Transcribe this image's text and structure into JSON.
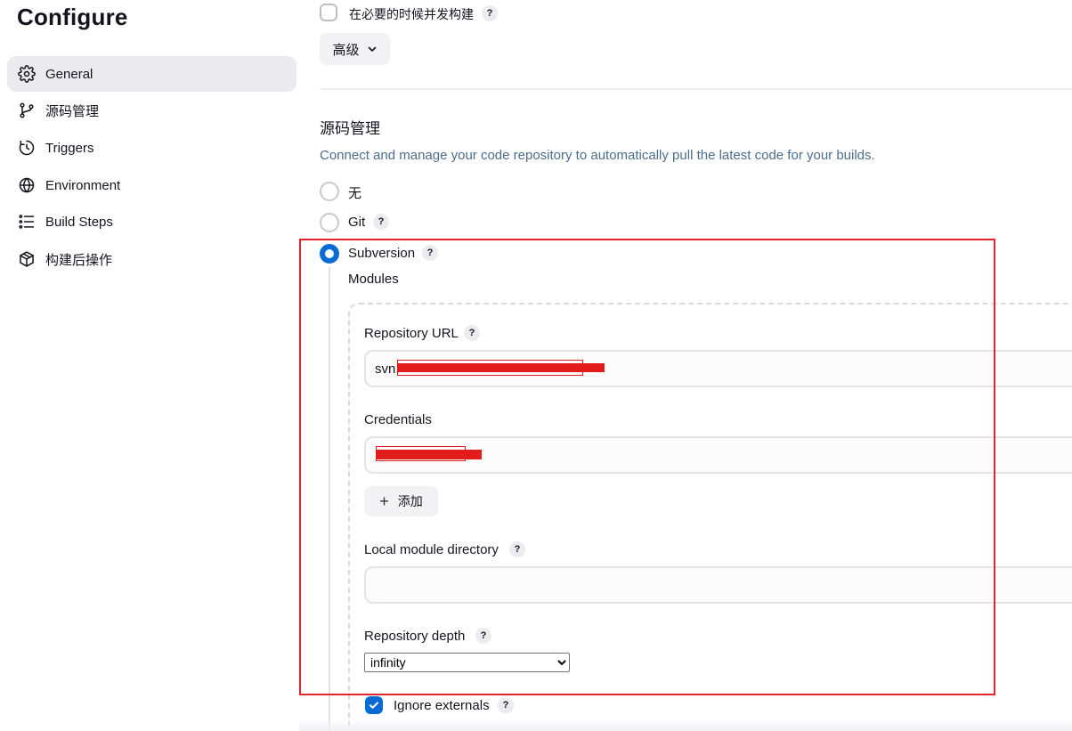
{
  "page_title": "Configure",
  "sidebar": {
    "items": [
      {
        "label": "General",
        "icon": "gear-icon",
        "active": true
      },
      {
        "label": "源码管理",
        "icon": "branch-icon",
        "active": false
      },
      {
        "label": "Triggers",
        "icon": "clock-icon",
        "active": false
      },
      {
        "label": "Environment",
        "icon": "globe-icon",
        "active": false
      },
      {
        "label": "Build Steps",
        "icon": "list-icon",
        "active": false
      },
      {
        "label": "构建后操作",
        "icon": "package-icon",
        "active": false
      }
    ]
  },
  "general": {
    "concurrent_build_label": "在必要的时候并发构建",
    "concurrent_build_checked": false,
    "advanced_button_label": "高级"
  },
  "scm": {
    "title": "源码管理",
    "description": "Connect and manage your code repository to automatically pull the latest code for your builds.",
    "options": [
      {
        "label": "无",
        "selected": false
      },
      {
        "label": "Git",
        "selected": false
      },
      {
        "label": "Subversion",
        "selected": true
      }
    ],
    "modules_label": "Modules",
    "repository_url_label": "Repository URL",
    "repository_url_value": "svn:",
    "credentials_label": "Credentials",
    "add_button_label": "添加",
    "local_module_directory_label": "Local module directory",
    "local_module_directory_value": "",
    "repository_depth_label": "Repository depth",
    "repository_depth_value": "infinity",
    "ignore_externals_label": "Ignore externals",
    "ignore_externals_checked": true
  },
  "help_glyph": "?",
  "colors": {
    "accent": "#0b6bd5",
    "highlight_box": "#e0262a",
    "redaction": "#e21b1b",
    "description_text": "#4a6d8c",
    "active_sidebar_bg": "#ebebef"
  }
}
